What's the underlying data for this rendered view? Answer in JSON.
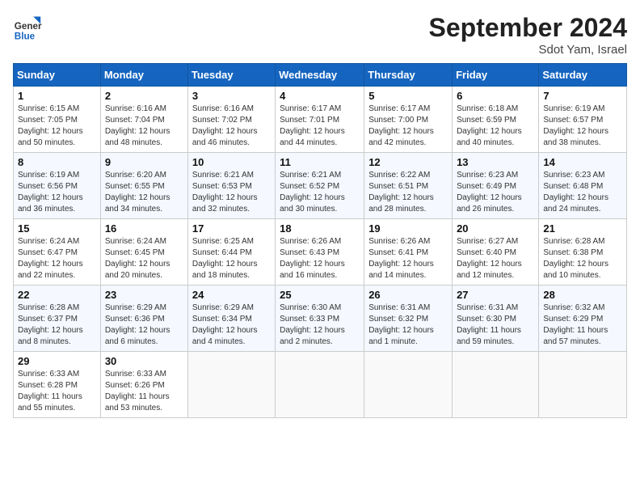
{
  "header": {
    "logo_general": "General",
    "logo_blue": "Blue",
    "month_title": "September 2024",
    "subtitle": "Sdot Yam, Israel"
  },
  "weekdays": [
    "Sunday",
    "Monday",
    "Tuesday",
    "Wednesday",
    "Thursday",
    "Friday",
    "Saturday"
  ],
  "weeks": [
    [
      {
        "day": "1",
        "info": "Sunrise: 6:15 AM\nSunset: 7:05 PM\nDaylight: 12 hours\nand 50 minutes."
      },
      {
        "day": "2",
        "info": "Sunrise: 6:16 AM\nSunset: 7:04 PM\nDaylight: 12 hours\nand 48 minutes."
      },
      {
        "day": "3",
        "info": "Sunrise: 6:16 AM\nSunset: 7:02 PM\nDaylight: 12 hours\nand 46 minutes."
      },
      {
        "day": "4",
        "info": "Sunrise: 6:17 AM\nSunset: 7:01 PM\nDaylight: 12 hours\nand 44 minutes."
      },
      {
        "day": "5",
        "info": "Sunrise: 6:17 AM\nSunset: 7:00 PM\nDaylight: 12 hours\nand 42 minutes."
      },
      {
        "day": "6",
        "info": "Sunrise: 6:18 AM\nSunset: 6:59 PM\nDaylight: 12 hours\nand 40 minutes."
      },
      {
        "day": "7",
        "info": "Sunrise: 6:19 AM\nSunset: 6:57 PM\nDaylight: 12 hours\nand 38 minutes."
      }
    ],
    [
      {
        "day": "8",
        "info": "Sunrise: 6:19 AM\nSunset: 6:56 PM\nDaylight: 12 hours\nand 36 minutes."
      },
      {
        "day": "9",
        "info": "Sunrise: 6:20 AM\nSunset: 6:55 PM\nDaylight: 12 hours\nand 34 minutes."
      },
      {
        "day": "10",
        "info": "Sunrise: 6:21 AM\nSunset: 6:53 PM\nDaylight: 12 hours\nand 32 minutes."
      },
      {
        "day": "11",
        "info": "Sunrise: 6:21 AM\nSunset: 6:52 PM\nDaylight: 12 hours\nand 30 minutes."
      },
      {
        "day": "12",
        "info": "Sunrise: 6:22 AM\nSunset: 6:51 PM\nDaylight: 12 hours\nand 28 minutes."
      },
      {
        "day": "13",
        "info": "Sunrise: 6:23 AM\nSunset: 6:49 PM\nDaylight: 12 hours\nand 26 minutes."
      },
      {
        "day": "14",
        "info": "Sunrise: 6:23 AM\nSunset: 6:48 PM\nDaylight: 12 hours\nand 24 minutes."
      }
    ],
    [
      {
        "day": "15",
        "info": "Sunrise: 6:24 AM\nSunset: 6:47 PM\nDaylight: 12 hours\nand 22 minutes."
      },
      {
        "day": "16",
        "info": "Sunrise: 6:24 AM\nSunset: 6:45 PM\nDaylight: 12 hours\nand 20 minutes."
      },
      {
        "day": "17",
        "info": "Sunrise: 6:25 AM\nSunset: 6:44 PM\nDaylight: 12 hours\nand 18 minutes."
      },
      {
        "day": "18",
        "info": "Sunrise: 6:26 AM\nSunset: 6:43 PM\nDaylight: 12 hours\nand 16 minutes."
      },
      {
        "day": "19",
        "info": "Sunrise: 6:26 AM\nSunset: 6:41 PM\nDaylight: 12 hours\nand 14 minutes."
      },
      {
        "day": "20",
        "info": "Sunrise: 6:27 AM\nSunset: 6:40 PM\nDaylight: 12 hours\nand 12 minutes."
      },
      {
        "day": "21",
        "info": "Sunrise: 6:28 AM\nSunset: 6:38 PM\nDaylight: 12 hours\nand 10 minutes."
      }
    ],
    [
      {
        "day": "22",
        "info": "Sunrise: 6:28 AM\nSunset: 6:37 PM\nDaylight: 12 hours\nand 8 minutes."
      },
      {
        "day": "23",
        "info": "Sunrise: 6:29 AM\nSunset: 6:36 PM\nDaylight: 12 hours\nand 6 minutes."
      },
      {
        "day": "24",
        "info": "Sunrise: 6:29 AM\nSunset: 6:34 PM\nDaylight: 12 hours\nand 4 minutes."
      },
      {
        "day": "25",
        "info": "Sunrise: 6:30 AM\nSunset: 6:33 PM\nDaylight: 12 hours\nand 2 minutes."
      },
      {
        "day": "26",
        "info": "Sunrise: 6:31 AM\nSunset: 6:32 PM\nDaylight: 12 hours\nand 1 minute."
      },
      {
        "day": "27",
        "info": "Sunrise: 6:31 AM\nSunset: 6:30 PM\nDaylight: 11 hours\nand 59 minutes."
      },
      {
        "day": "28",
        "info": "Sunrise: 6:32 AM\nSunset: 6:29 PM\nDaylight: 11 hours\nand 57 minutes."
      }
    ],
    [
      {
        "day": "29",
        "info": "Sunrise: 6:33 AM\nSunset: 6:28 PM\nDaylight: 11 hours\nand 55 minutes."
      },
      {
        "day": "30",
        "info": "Sunrise: 6:33 AM\nSunset: 6:26 PM\nDaylight: 11 hours\nand 53 minutes."
      },
      {
        "day": "",
        "info": ""
      },
      {
        "day": "",
        "info": ""
      },
      {
        "day": "",
        "info": ""
      },
      {
        "day": "",
        "info": ""
      },
      {
        "day": "",
        "info": ""
      }
    ]
  ]
}
